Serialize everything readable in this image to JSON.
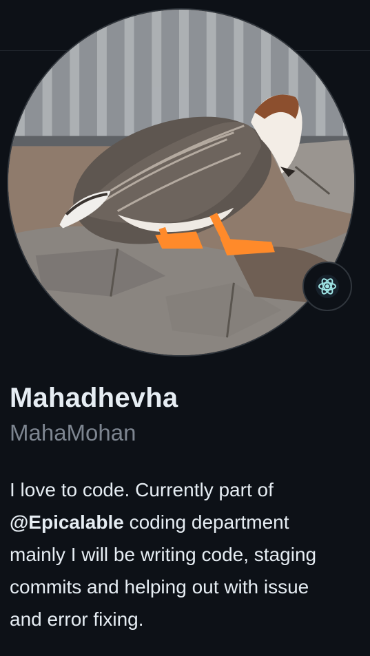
{
  "profile": {
    "name": "Mahadhevha",
    "login": "MahaMohan",
    "avatar_icon": "goose-avatar",
    "status_icon": "atom-emoji-icon",
    "bio": {
      "line1": "I love to code. Currently part of",
      "mention": "@Epicalable",
      "line2_rest": " coding department",
      "line3": "mainly I will be writing code, staging",
      "line4": "commits and helping out with issue",
      "line5": "and error fixing."
    }
  },
  "colors": {
    "background": "#0d1117",
    "name": "#e6edf3",
    "login": "#7d8590",
    "border": "#30363d"
  }
}
